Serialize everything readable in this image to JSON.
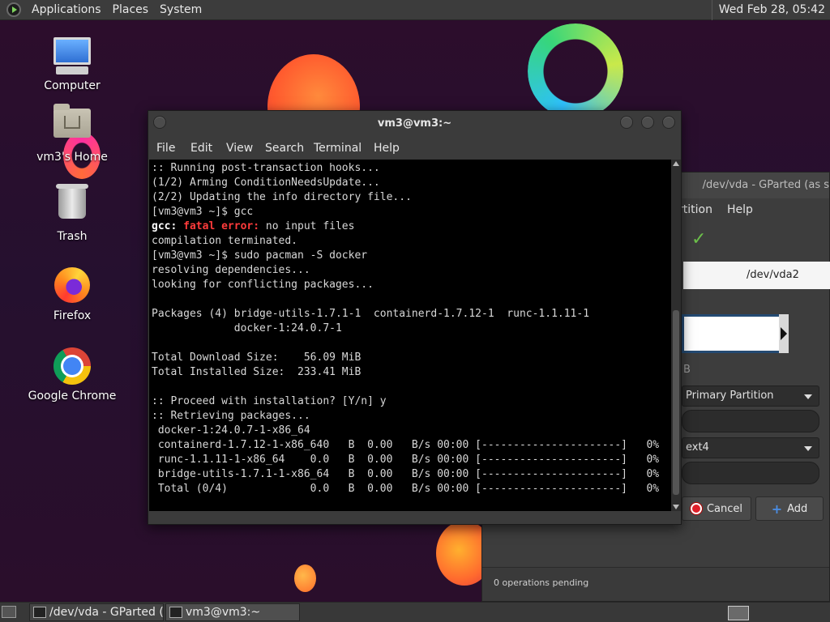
{
  "top_panel": {
    "menus": [
      "Applications",
      "Places",
      "System"
    ],
    "clock": "Wed Feb 28, 05:42"
  },
  "desktop_icons": [
    {
      "label": "Computer",
      "icon": "computer-icon"
    },
    {
      "label": "vm3's Home",
      "icon": "home-folder-icon"
    },
    {
      "label": "Trash",
      "icon": "trash-icon"
    },
    {
      "label": "Firefox",
      "icon": "firefox-icon"
    },
    {
      "label": "Google Chrome",
      "icon": "chrome-icon"
    }
  ],
  "terminal": {
    "title": "vm3@vm3:~",
    "menus": [
      "File",
      "Edit",
      "View",
      "Search",
      "Terminal",
      "Help"
    ],
    "lines": {
      "l1": ":: Running post-transaction hooks...",
      "l2": "(1/2) Arming ConditionNeedsUpdate...",
      "l3": "(2/2) Updating the info directory file...",
      "l4": "[vm3@vm3 ~]$ gcc",
      "l5a": "gcc:",
      "l5b": "fatal error:",
      "l5c": " no input files",
      "l6": "compilation terminated.",
      "l7": "[vm3@vm3 ~]$ sudo pacman -S docker",
      "l8": "resolving dependencies...",
      "l9": "looking for conflicting packages...",
      "l10": "",
      "l11": "Packages (4) bridge-utils-1.7.1-1  containerd-1.7.12-1  runc-1.1.11-1",
      "l12": "             docker-1:24.0.7-1",
      "l13": "",
      "l14": "Total Download Size:    56.09 MiB",
      "l15": "Total Installed Size:  233.41 MiB",
      "l16": "",
      "l17": ":: Proceed with installation? [Y/n] y",
      "l18": ":: Retrieving packages...",
      "l19": " docker-1:24.0.7-1-x86_64",
      "l20": " containerd-1.7.12-1-x86_640   B  0.00   B/s 00:00 [----------------------]   0%",
      "l21": " runc-1.1.11-1-x86_64    0.0   B  0.00   B/s 00:00 [----------------------]   0%",
      "l22": " bridge-utils-1.7.1-1-x86_64   B  0.00   B/s 00:00 [----------------------]   0%",
      "l23": " Total (0/4)             0.0   B  0.00   B/s 00:00 [----------------------]   0%"
    }
  },
  "gparted": {
    "title": "/dev/vda - GParted (as s",
    "menus": [
      "rtition",
      "Help"
    ],
    "device": "/dev/vda2",
    "size_unit": "B",
    "partition_type": "Primary Partition",
    "filesystem": "ext4",
    "cancel_label": "Cancel",
    "add_label": "Add",
    "status": "0 operations pending"
  },
  "taskbar": {
    "tasks": [
      "/dev/vda - GParted (...",
      "vm3@vm3:~"
    ]
  }
}
